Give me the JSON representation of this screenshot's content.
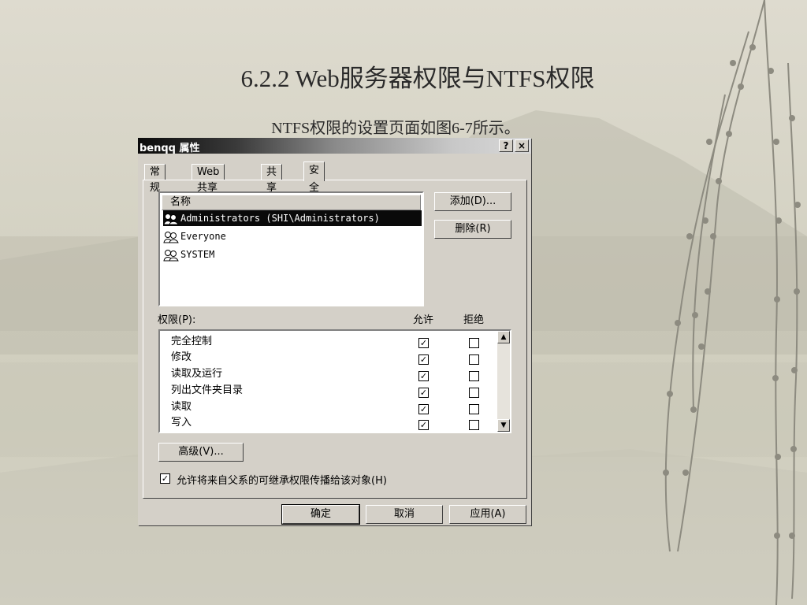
{
  "slide": {
    "title": "6.2.2 Web服务器权限与NTFS权限",
    "subtitle": "NTFS权限的设置页面如图6-7所示。"
  },
  "dialog": {
    "title": "benqq 属性",
    "help_btn": "?",
    "close_btn": "×",
    "tabs": [
      "常规",
      "Web 共享",
      "共享",
      "安全"
    ],
    "active_tab": "安全",
    "names_header": "名称",
    "principals": [
      {
        "name": "Administrators (SHI\\Administrators)",
        "selected": true,
        "icon": "group-icon"
      },
      {
        "name": "Everyone",
        "selected": false,
        "icon": "group-icon"
      },
      {
        "name": "SYSTEM",
        "selected": false,
        "icon": "group-icon"
      }
    ],
    "add_button": "添加(D)...",
    "remove_button": "删除(R)",
    "permissions_label": "权限(P):",
    "allow_header": "允许",
    "deny_header": "拒绝",
    "permissions": [
      {
        "name": "完全控制",
        "allow": true,
        "deny": false
      },
      {
        "name": "修改",
        "allow": true,
        "deny": false
      },
      {
        "name": "读取及运行",
        "allow": true,
        "deny": false
      },
      {
        "name": "列出文件夹目录",
        "allow": true,
        "deny": false
      },
      {
        "name": "读取",
        "allow": true,
        "deny": false
      },
      {
        "name": "写入",
        "allow": true,
        "deny": false
      }
    ],
    "advanced_button": "高级(V)...",
    "inherit_label": "允许将来自父系的可继承权限传播给该对象(H)",
    "inherit_checked": true,
    "ok_button": "确定",
    "cancel_button": "取消",
    "apply_button": "应用(A)",
    "check_glyph": "✓"
  }
}
